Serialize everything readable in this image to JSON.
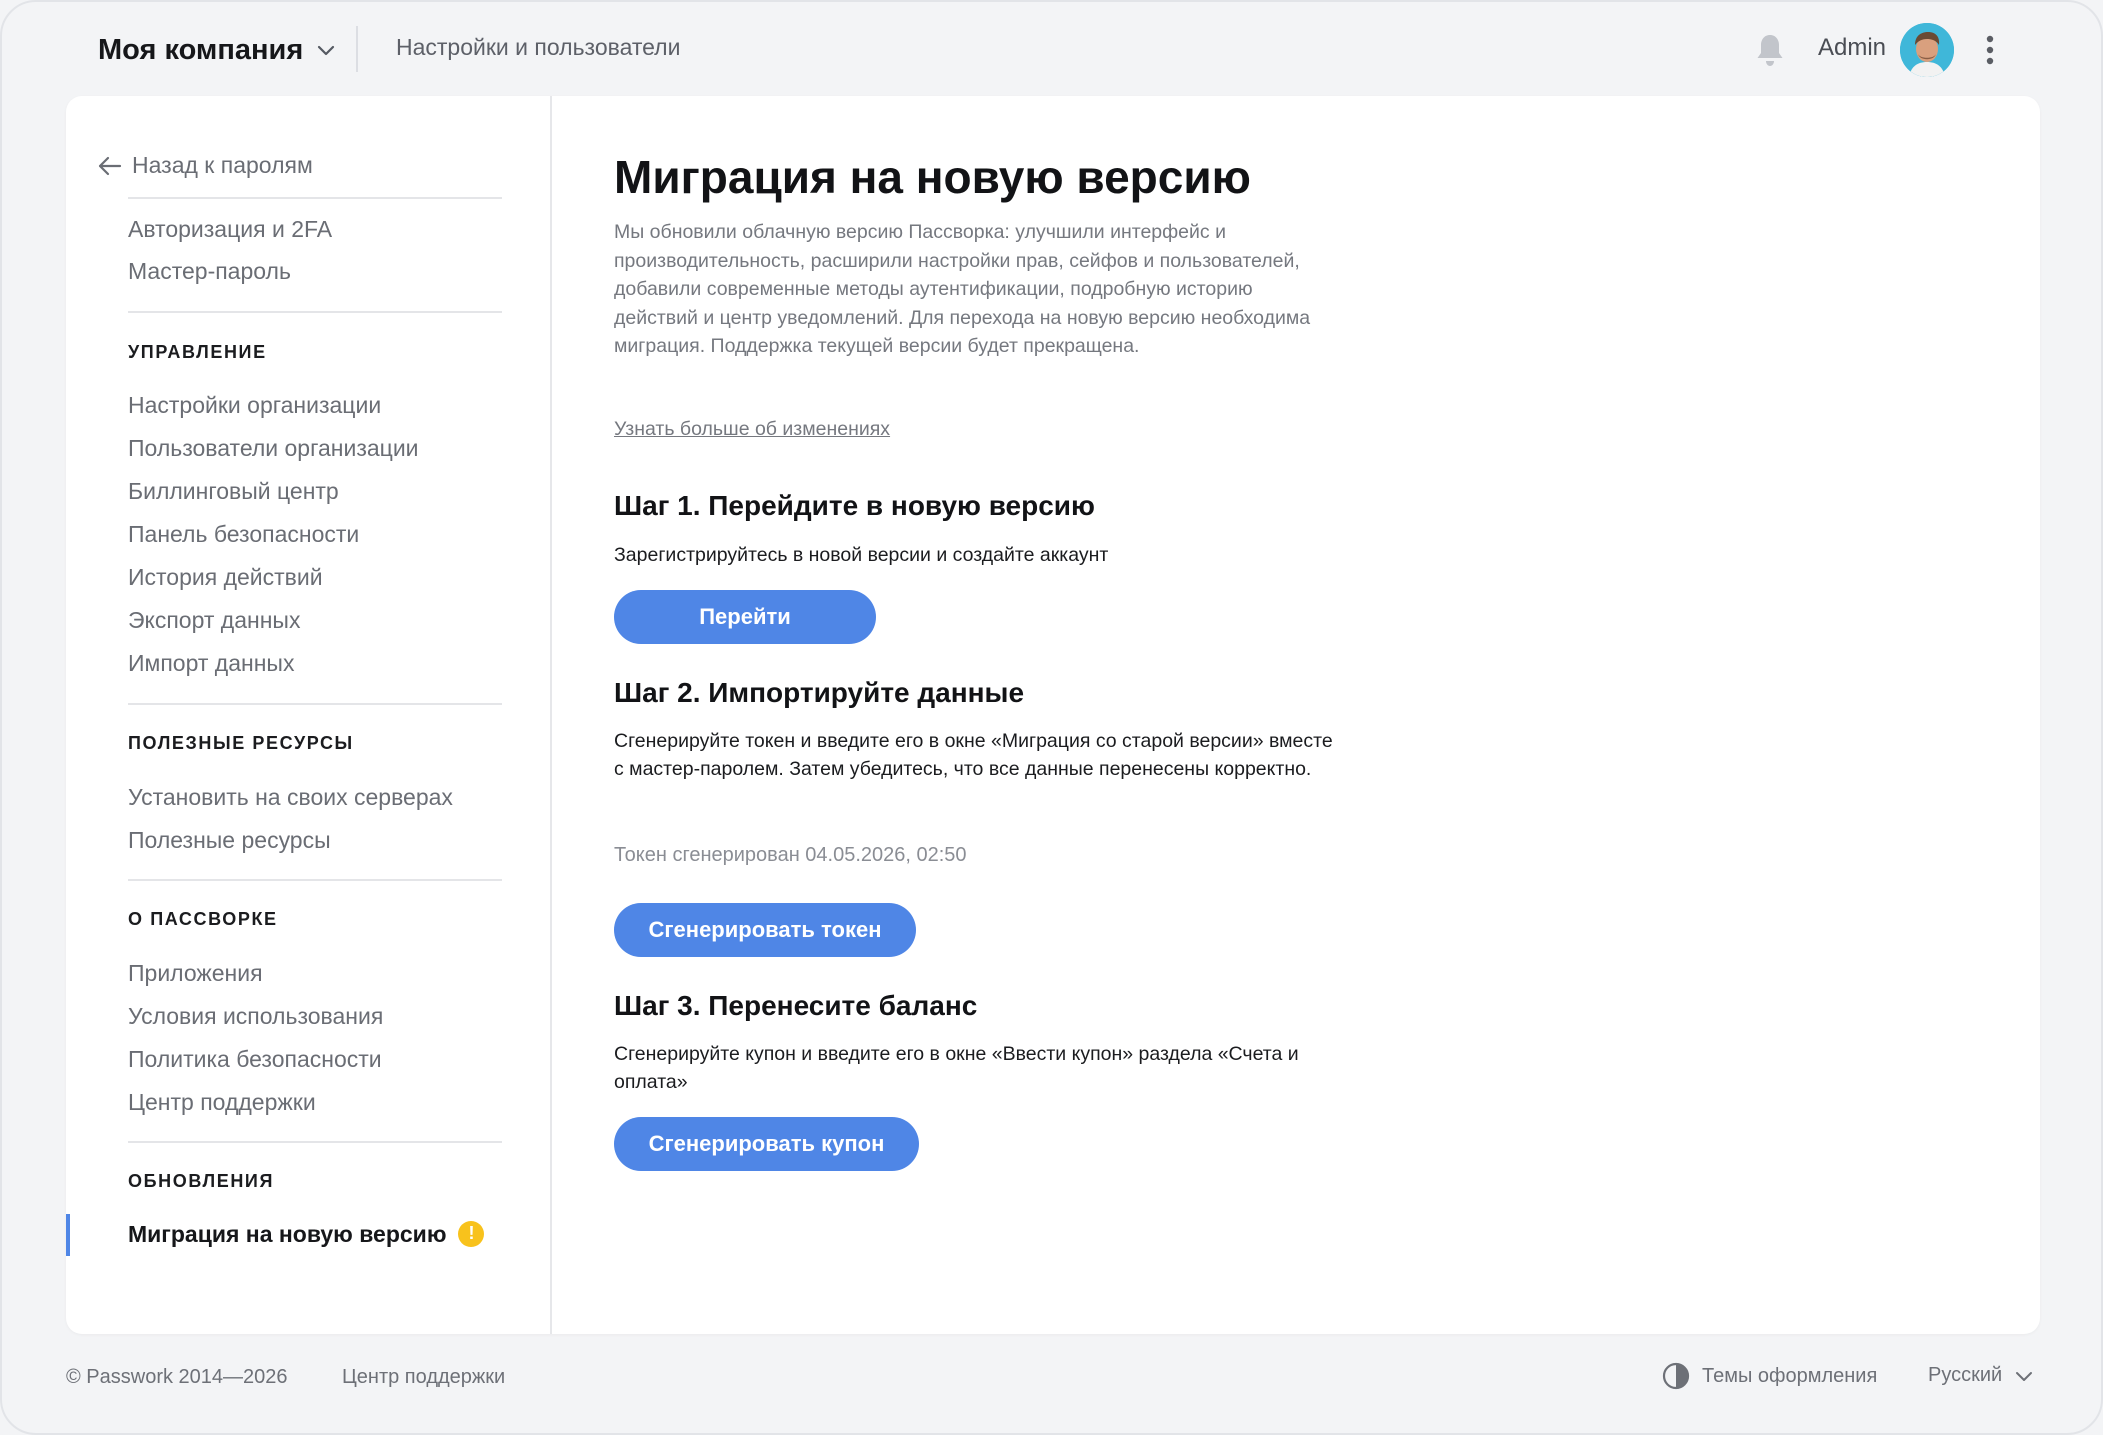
{
  "header": {
    "company": "Моя компания",
    "section": "Настройки и пользователи",
    "user_name": "Admin"
  },
  "sidebar": {
    "back": "Назад к паролям",
    "top_items": [
      "Авторизация и 2FA",
      "Мастер-пароль"
    ],
    "groups": [
      {
        "title": "УПРАВЛЕНИЕ",
        "items": [
          "Настройки организации",
          "Пользователи организации",
          "Биллинговый центр",
          "Панель безопасности",
          "История действий",
          "Экспорт данных",
          "Импорт данных"
        ]
      },
      {
        "title": "ПОЛЕЗНЫЕ РЕСУРСЫ",
        "items": [
          "Установить на своих серверах",
          "Полезные ресурсы"
        ]
      },
      {
        "title": "О ПАССВОРКЕ",
        "items": [
          "Приложения",
          "Условия использования",
          "Политика безопасности",
          "Центр поддержки"
        ]
      },
      {
        "title": "ОБНОВЛЕНИЯ",
        "items": [
          "Миграция на новую версию"
        ]
      }
    ],
    "active_item": "Миграция на новую версию",
    "warning_badge": "!"
  },
  "main": {
    "title": "Миграция на новую версию",
    "intro": "Мы обновили облачную версию Пассворка: улучшили интерфейс и производительность, расширили настройки прав, сейфов и пользователей, добавили современные методы аутентификации, подробную историю действий и центр уведомлений. Для перехода на новую версию необходима миграция. Поддержка текущей версии будет прекращена.",
    "more_link": "Узнать больше об изменениях",
    "steps": [
      {
        "title": "Шаг 1. Перейдите в новую версию",
        "text": "Зарегистрируйтесь в новой версии и создайте аккаунт",
        "button": "Перейти"
      },
      {
        "title": "Шаг 2. Импортируйте данные",
        "text": "Сгенерируйте токен и введите его в окне «Миграция со старой версии» вместе с мастер-паролем. Затем убедитесь, что все данные перенесены корректно.",
        "status": "Токен сгенерирован 04.05.2026, 02:50",
        "button": "Сгенерировать токен"
      },
      {
        "title": "Шаг 3. Перенесите баланс",
        "text": "Сгенерируйте купон и введите его в окне «Ввести купон» раздела «Счета и оплата»",
        "button": "Сгенерировать купон"
      }
    ]
  },
  "footer": {
    "copyright": "© Passwork 2014—2026",
    "support": "Центр поддержки",
    "themes": "Темы оформления",
    "language": "Русский"
  },
  "colors": {
    "accent": "#4f86e6",
    "warning": "#f8c21c",
    "background": "#f3f4f6",
    "card": "#ffffff"
  },
  "icons": [
    "chevron-down-icon",
    "bell-icon",
    "kebab-menu-icon",
    "arrow-left-icon",
    "warning-icon",
    "theme-contrast-icon"
  ]
}
